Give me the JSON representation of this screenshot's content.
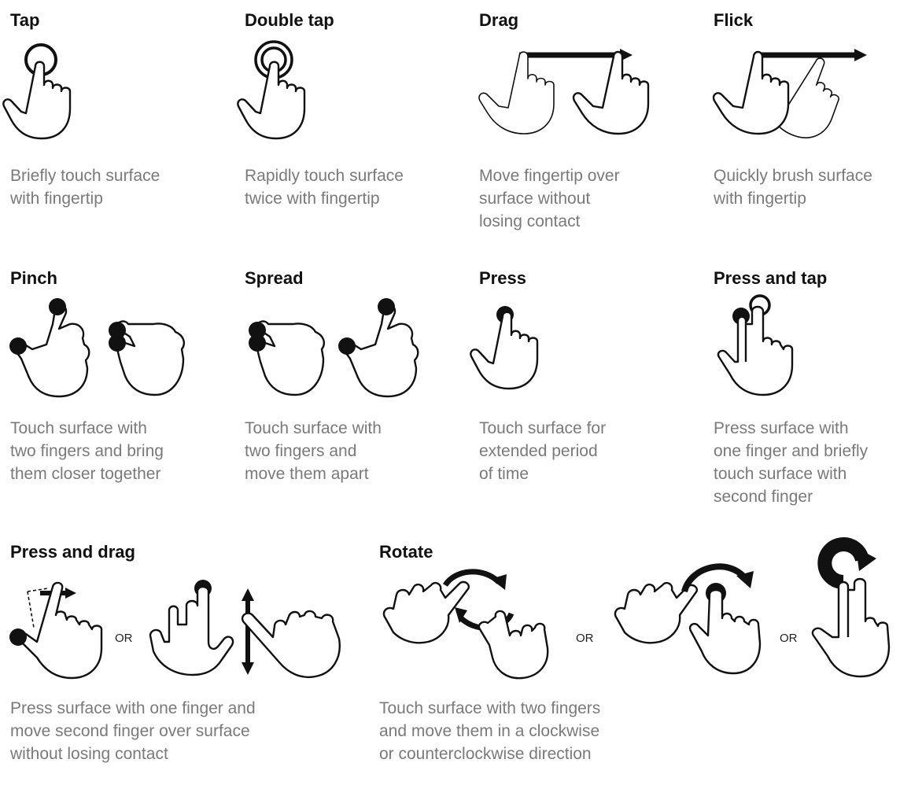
{
  "gestures": [
    {
      "id": "tap",
      "title": "Tap",
      "desc": [
        "Briefly touch surface",
        "with fingertip"
      ]
    },
    {
      "id": "double_tap",
      "title": "Double tap",
      "desc": [
        "Rapidly touch surface",
        "twice with fingertip"
      ]
    },
    {
      "id": "drag",
      "title": "Drag",
      "desc": [
        "Move fingertip over",
        "surface without",
        "losing contact"
      ]
    },
    {
      "id": "flick",
      "title": "Flick",
      "desc": [
        "Quickly brush surface",
        "with fingertip"
      ]
    },
    {
      "id": "pinch",
      "title": "Pinch",
      "desc": [
        "Touch surface with",
        "two fingers and bring",
        "them closer together"
      ]
    },
    {
      "id": "spread",
      "title": "Spread",
      "desc": [
        "Touch surface with",
        "two fingers and",
        "move them apart"
      ]
    },
    {
      "id": "press",
      "title": "Press",
      "desc": [
        "Touch surface for",
        "extended period",
        "of time"
      ]
    },
    {
      "id": "press_tap",
      "title": "Press and tap",
      "desc": [
        "Press surface with",
        "one finger and briefly",
        "touch surface with",
        "second finger"
      ]
    },
    {
      "id": "press_drag",
      "title": "Press and drag",
      "desc": [
        "Press surface with one finger and",
        "move second finger over surface",
        "without losing contact"
      ]
    },
    {
      "id": "rotate",
      "title": "Rotate",
      "desc": [
        "Touch surface with two fingers",
        "and move them in a clockwise",
        "or counterclockwise direction"
      ]
    }
  ],
  "or_label": "OR",
  "colors": {
    "title": "#111111",
    "description": "#7a7a7a",
    "line": "#111111"
  },
  "icons": [
    "tap-hand-icon",
    "double-tap-hand-icon",
    "drag-hands-icon",
    "flick-hands-icon",
    "pinch-hands-icon",
    "spread-hands-icon",
    "press-hand-icon",
    "press-and-tap-hand-icon",
    "press-and-drag-hands-icon",
    "rotate-hands-icon"
  ]
}
